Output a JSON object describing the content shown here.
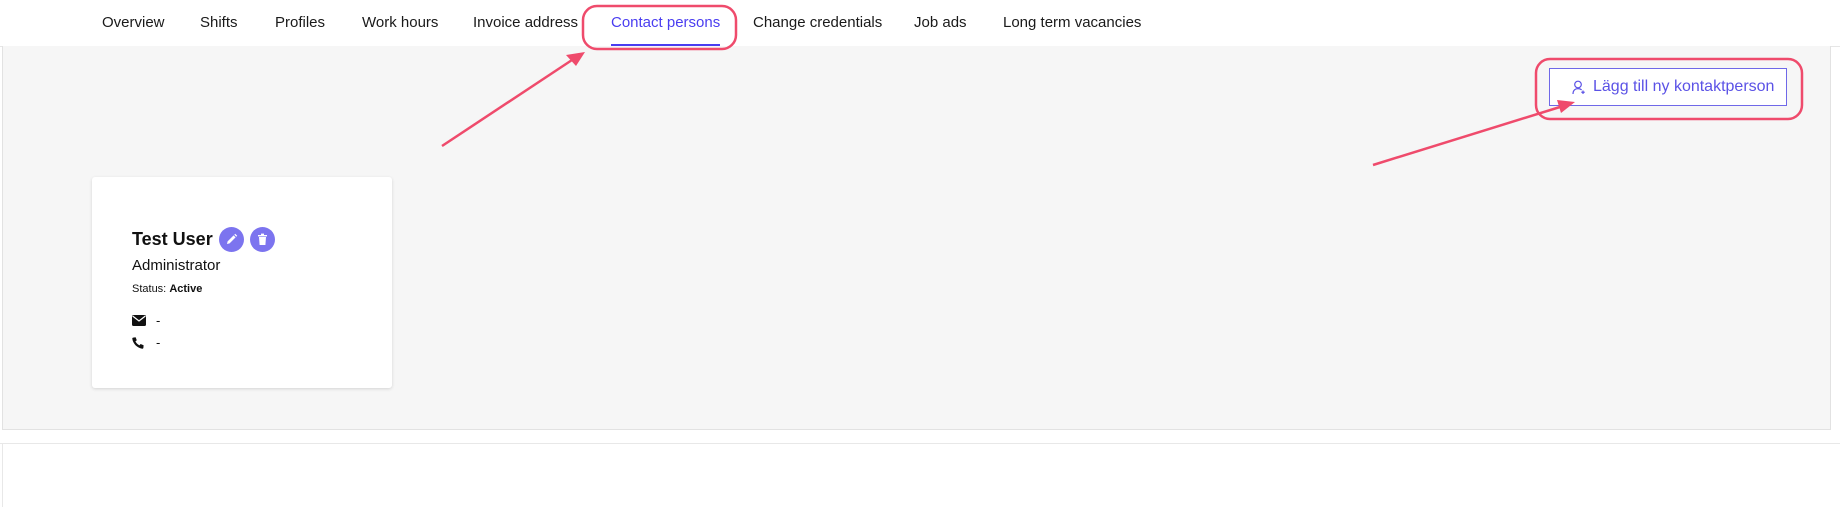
{
  "tabs": [
    {
      "label": "Overview"
    },
    {
      "label": "Shifts"
    },
    {
      "label": "Profiles"
    },
    {
      "label": "Work hours"
    },
    {
      "label": "Invoice address"
    },
    {
      "label": "Contact persons",
      "active": true
    },
    {
      "label": "Change credentials"
    },
    {
      "label": "Job ads"
    },
    {
      "label": "Long term vacancies"
    }
  ],
  "toolbar": {
    "add_contact_label": "Lägg till ny kontaktperson",
    "add_contact_icon": "user-plus-icon"
  },
  "contact_card": {
    "name": "Test User",
    "role": "Administrator",
    "status_label": "Status:",
    "status_value": "Active",
    "email": "-",
    "phone": "-",
    "icons": [
      "edit-icon",
      "trash-icon",
      "envelope-icon",
      "phone-icon"
    ]
  },
  "colors": {
    "accent": "#4a3df0",
    "button_text": "#5b52e6",
    "icon_button_bg": "#7c74ef",
    "annotation": "#ef4b6c",
    "panel_bg": "#f6f6f6"
  }
}
